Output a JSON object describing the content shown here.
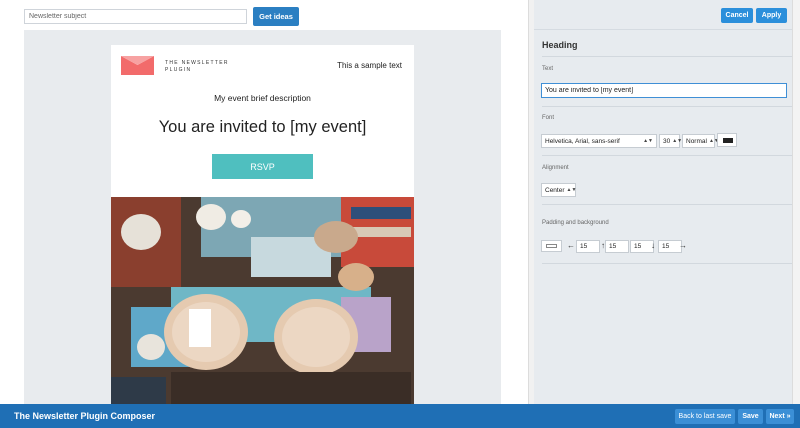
{
  "header": {
    "subject_placeholder": "Newsletter subject",
    "get_ideas_label": "Get ideas"
  },
  "email": {
    "logo_text": "THE NEWSLETTER PLUGIN",
    "sample_text": "This a sample text",
    "brief_description": "My event brief description",
    "heading": "You are invited to [my event]",
    "button_label": "RSVP",
    "brand_color": "#f26b6b",
    "button_color": "#4fbfbf"
  },
  "panel": {
    "cancel_label": "Cancel",
    "apply_label": "Apply",
    "section_title": "Heading",
    "text_label": "Text",
    "text_value": "You are invited to [my event]",
    "font_label": "Font",
    "font_family": "Helvetica, Arial, sans-serif",
    "font_size": "30",
    "font_weight": "Normal",
    "font_color": "#222222",
    "alignment_label": "Alignment",
    "alignment_value": "Center",
    "padding_label": "Padding and background",
    "padding_left": "15",
    "padding_top": "15",
    "padding_right": "15",
    "padding_bottom": "15",
    "icons": {
      "select_arrows": "up-down-arrows-icon",
      "left": "arrow-left-icon",
      "up": "arrow-up-icon",
      "down": "arrow-down-icon",
      "right": "arrow-right-icon"
    }
  },
  "footer": {
    "app_title": "The Newsletter Plugin Composer",
    "back_label": "Back to last save",
    "save_label": "Save",
    "next_label": "Next »"
  },
  "colors": {
    "primary_blue": "#2b8fdb",
    "bottom_bar": "#1f6fb5",
    "panel_bg": "#e7ebef"
  }
}
